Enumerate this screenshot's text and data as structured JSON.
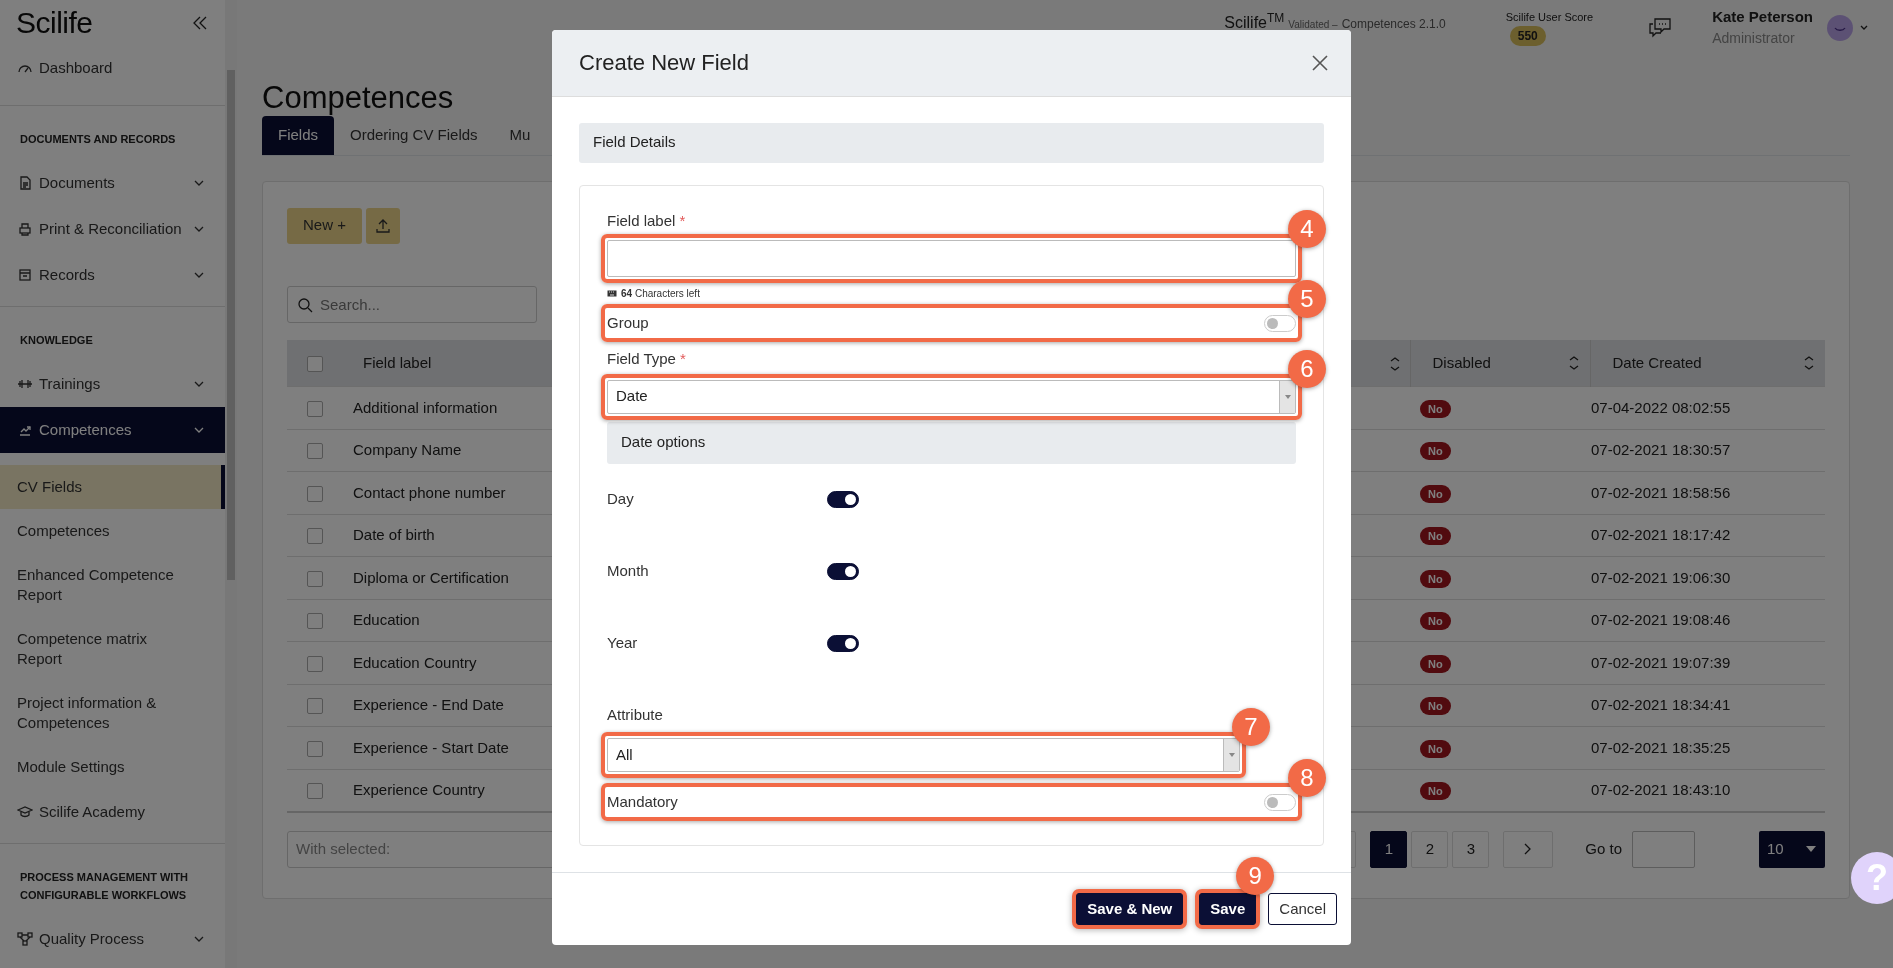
{
  "sidebar": {
    "logo": "Scilife",
    "sections": [
      {
        "items": [
          {
            "label": "Dashboard",
            "expandable": false,
            "selected": false
          }
        ]
      },
      {
        "title": "DOCUMENTS AND RECORDS",
        "items": [
          {
            "label": "Documents",
            "expandable": true,
            "selected": false
          },
          {
            "label": "Print & Reconciliation",
            "expandable": true,
            "selected": false
          },
          {
            "label": "Records",
            "expandable": true,
            "selected": false
          }
        ]
      },
      {
        "title": "KNOWLEDGE",
        "items": [
          {
            "label": "Trainings",
            "expandable": true,
            "selected": false
          },
          {
            "label": "Competences",
            "expandable": true,
            "selected": true,
            "children": [
              {
                "label": "CV Fields",
                "selected": true
              },
              {
                "label": "Competences",
                "selected": false
              },
              {
                "label": "Enhanced Competence Report",
                "selected": false
              },
              {
                "label": "Competence matrix Report",
                "selected": false
              },
              {
                "label": "Project information & Competences",
                "selected": false
              },
              {
                "label": "Module Settings",
                "selected": false
              }
            ]
          },
          {
            "label": "Scilife Academy",
            "expandable": false,
            "selected": false
          }
        ]
      },
      {
        "title": "PROCESS MANAGEMENT WITH CONFIGURABLE WORKFLOWS",
        "items": [
          {
            "label": "Quality Process",
            "expandable": true,
            "selected": false
          }
        ]
      }
    ]
  },
  "header": {
    "brand": "Scilife$^{TM}$",
    "edition": "Validated –",
    "version": "Competences 2.1.0",
    "score_label": "Scilife User Score",
    "score": "550",
    "user_name": "Kate Peterson",
    "user_role": "Administrator"
  },
  "page": {
    "title": "Competences",
    "tabs": [
      {
        "label": "Fields",
        "selected": true
      },
      {
        "label": "Ordering CV Fields",
        "selected": false
      },
      {
        "label": "Mu",
        "selected": false
      }
    ],
    "new_button": "New +",
    "search": {
      "placeholder": "Search..."
    },
    "table": {
      "columns": [
        "Field label",
        "Disabled",
        "Date Created"
      ],
      "select_all_checked": false,
      "rows": [
        {
          "checked": false,
          "field_label": "Additional information",
          "disabled": "No",
          "date_created": "07-04-2022 08:02:55"
        },
        {
          "checked": false,
          "field_label": "Company Name",
          "disabled": "No",
          "date_created": "07-02-2021 18:30:57"
        },
        {
          "checked": false,
          "field_label": "Contact phone number",
          "disabled": "No",
          "date_created": "07-02-2021 18:58:56"
        },
        {
          "checked": false,
          "field_label": "Date of birth",
          "disabled": "No",
          "date_created": "07-02-2021 18:17:42"
        },
        {
          "checked": false,
          "field_label": "Diploma or Certification",
          "disabled": "No",
          "date_created": "07-02-2021 19:06:30"
        },
        {
          "checked": false,
          "field_label": "Education",
          "disabled": "No",
          "date_created": "07-02-2021 19:08:46"
        },
        {
          "checked": false,
          "field_label": "Education Country",
          "disabled": "No",
          "date_created": "07-02-2021 19:07:39"
        },
        {
          "checked": false,
          "field_label": "Experience - End Date",
          "disabled": "No",
          "date_created": "07-02-2021 18:34:41"
        },
        {
          "checked": false,
          "field_label": "Experience - Start Date",
          "disabled": "No",
          "date_created": "07-02-2021 18:35:25"
        },
        {
          "checked": false,
          "field_label": "Experience Country",
          "disabled": "No",
          "date_created": "07-02-2021 18:43:10"
        }
      ]
    },
    "bulk_action": {
      "placeholder": "With selected:"
    },
    "pagination": {
      "pages": [
        {
          "label": "1",
          "selected": true
        },
        {
          "label": "2",
          "selected": false
        },
        {
          "label": "3",
          "selected": false
        }
      ],
      "go_to_label": "Go to",
      "page_size": "10"
    },
    "help": "?"
  },
  "modal": {
    "title": "Create New Field",
    "section_title": "Field Details",
    "field_label": {
      "label": "Field label",
      "required_mark": "*",
      "chars_left": "**64** Characters left",
      "callout": "4"
    },
    "group": {
      "label": "Group",
      "on": false,
      "callout": "5"
    },
    "field_type": {
      "label": "Field Type",
      "required_mark": "*",
      "value": "Date",
      "callout": "6"
    },
    "date_options": {
      "title": "Date options",
      "toggles": [
        {
          "label": "Day",
          "on": true
        },
        {
          "label": "Month",
          "on": true
        },
        {
          "label": "Year",
          "on": true
        }
      ]
    },
    "attribute": {
      "label": "Attribute",
      "value": "All",
      "callout": "7"
    },
    "mandatory": {
      "label": "Mandatory",
      "on": false,
      "callout": "8"
    },
    "buttons": [
      {
        "label": "Save & New",
        "kind": "primary",
        "outlined": true
      },
      {
        "label": "Save",
        "kind": "primary",
        "outlined": true,
        "callout": "9"
      },
      {
        "label": "Cancel",
        "kind": "secondary",
        "outlined": false
      }
    ]
  }
}
